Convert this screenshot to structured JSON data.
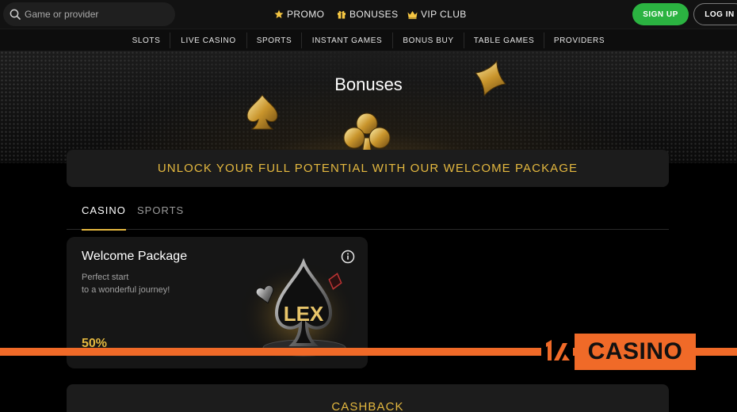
{
  "header": {
    "search_placeholder": "Game or provider",
    "links": [
      {
        "label": "PROMO",
        "icon": "star-icon"
      },
      {
        "label": "BONUSES",
        "icon": "gift-icon"
      },
      {
        "label": "VIP CLUB",
        "icon": "crown-icon"
      }
    ],
    "signup_label": "SIGN UP",
    "login_label": "LOG IN"
  },
  "nav": {
    "items": [
      "SLOTS",
      "LIVE CASINO",
      "SPORTS",
      "INSTANT GAMES",
      "BONUS BUY",
      "TABLE GAMES",
      "PROVIDERS"
    ]
  },
  "hero": {
    "title": "Bonuses"
  },
  "banner": {
    "text": "UNLOCK YOUR FULL POTENTIAL WITH OUR WELCOME PACKAGE"
  },
  "tabs": [
    {
      "label": "CASINO",
      "active": true
    },
    {
      "label": "SPORTS",
      "active": false
    }
  ],
  "card": {
    "title": "Welcome Package",
    "subtitle_line1": "Perfect start",
    "subtitle_line2": "to a wonderful journey!",
    "percent": "50%",
    "art_text": "LEX"
  },
  "cashback": {
    "label": "CASHBACK"
  },
  "watermark": {
    "text": "CASINO"
  },
  "colors": {
    "accent_gold": "#e4b83f",
    "signup_green": "#2bb341",
    "watermark_orange": "#f06a28"
  }
}
